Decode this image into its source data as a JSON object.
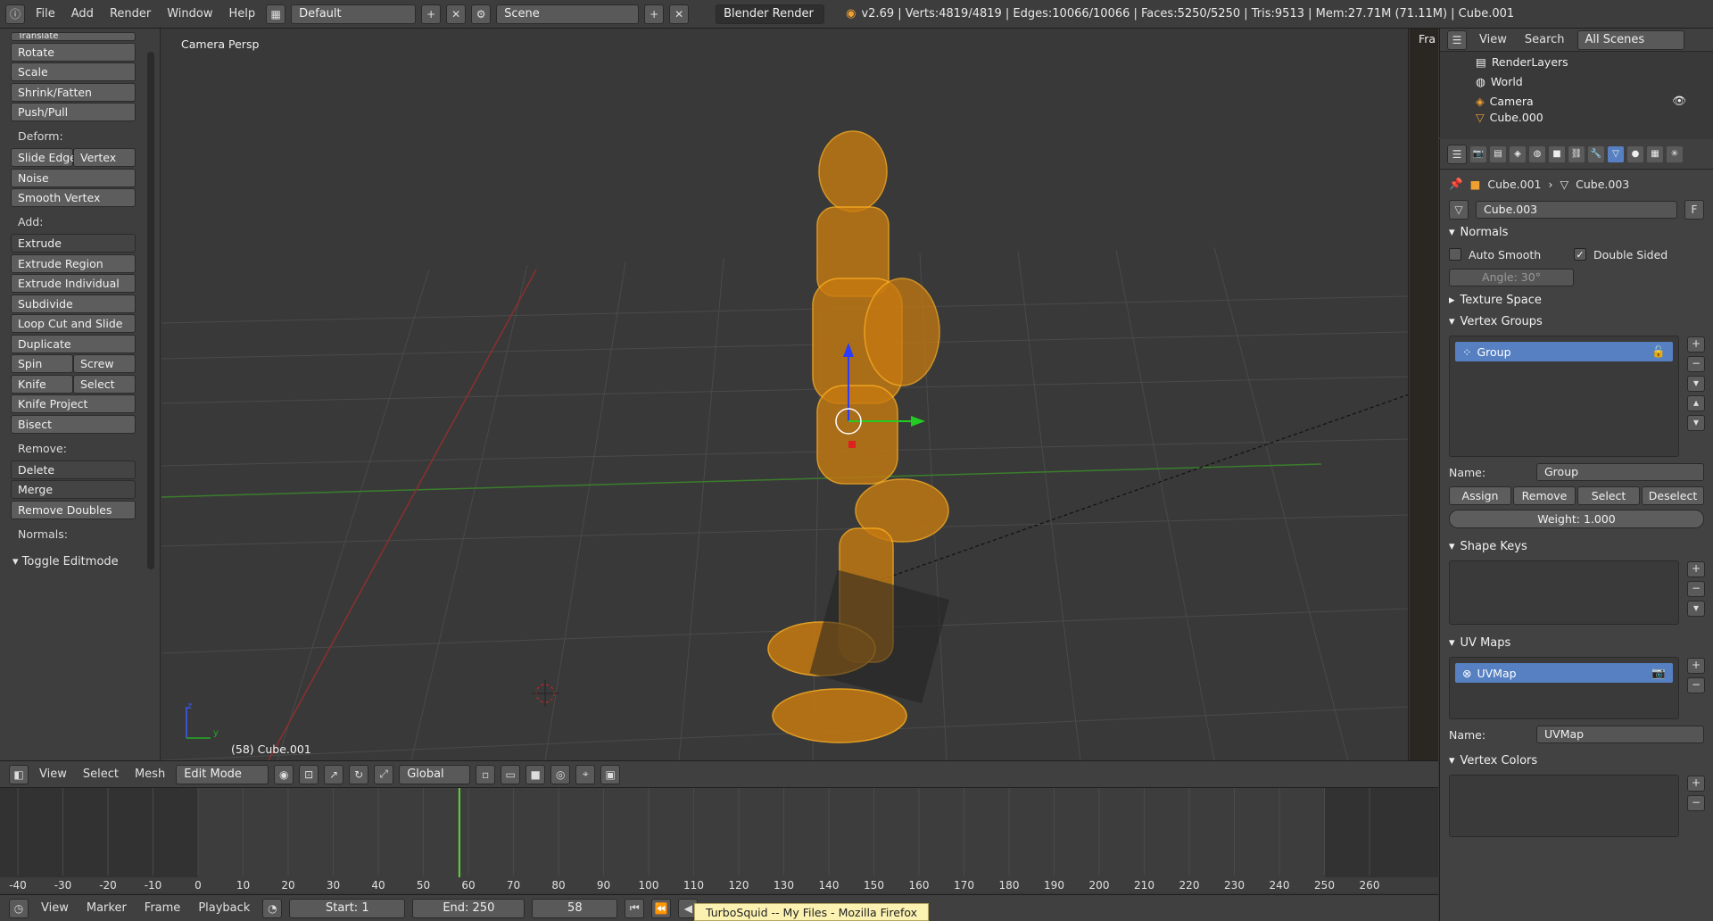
{
  "topbar": {
    "menus": [
      "File",
      "Add",
      "Render",
      "Window",
      "Help"
    ],
    "layout": "Default",
    "scene": "Scene",
    "engine": "Blender Render",
    "stats": "v2.69 | Verts:4819/4819 | Edges:10066/10066 | Faces:5250/5250 | Tris:9513 | Mem:27.71M (71.11M) | Cube.001"
  },
  "toolshelf": {
    "top_cut": "Translate",
    "transform_items": [
      "Rotate",
      "Scale",
      "Shrink/Fatten",
      "Push/Pull"
    ],
    "deform_label": "Deform:",
    "slide_edge": "Slide Edge",
    "vertex": "Vertex",
    "noise": "Noise",
    "smooth_vertex": "Smooth Vertex",
    "add_label": "Add:",
    "extrude": "Extrude",
    "extrude_region": "Extrude Region",
    "extrude_individual": "Extrude Individual",
    "subdivide": "Subdivide",
    "loop_cut": "Loop Cut and Slide",
    "duplicate": "Duplicate",
    "spin": "Spin",
    "screw": "Screw",
    "knife": "Knife",
    "select": "Select",
    "knife_project": "Knife Project",
    "bisect": "Bisect",
    "remove_label": "Remove:",
    "delete": "Delete",
    "merge": "Merge",
    "remove_doubles": "Remove Doubles",
    "normals_label": "Normals:",
    "toggle": "Toggle Editmode"
  },
  "viewport": {
    "view_name": "Camera Persp",
    "object_label": "(58) Cube.001",
    "corner_label": "Fra",
    "axis_z": "z",
    "axis_y": "y"
  },
  "vp_header": {
    "menus": [
      "View",
      "Select",
      "Mesh"
    ],
    "mode": "Edit Mode",
    "orientation": "Global"
  },
  "timeline": {
    "ticks": [
      "-40",
      "-30",
      "-20",
      "-10",
      "0",
      "10",
      "20",
      "30",
      "40",
      "50",
      "60",
      "70",
      "80",
      "90",
      "100",
      "110",
      "120",
      "130",
      "140",
      "150",
      "160",
      "170",
      "180",
      "190",
      "200",
      "210",
      "220",
      "230",
      "240",
      "250",
      "260"
    ],
    "current_frame": 58,
    "menus": [
      "View",
      "Marker",
      "Frame",
      "Playback"
    ],
    "start": "Start: 1",
    "end": "End: 250",
    "frame": "58",
    "tooltip": "TurboSquid -- My Files - Mozilla Firefox"
  },
  "outliner": {
    "view": "View",
    "search": "Search",
    "filter": "All Scenes",
    "items": [
      "RenderLayers",
      "World",
      "Camera",
      "Cube.000"
    ]
  },
  "props": {
    "breadcrumb_obj": "Cube.001",
    "breadcrumb_data": "Cube.003",
    "data_name": "Cube.003",
    "fake_user": "F",
    "normals": "Normals",
    "auto_smooth": "Auto Smooth",
    "double_sided": "Double Sided",
    "angle": "Angle: 30°",
    "texture_space": "Texture Space",
    "vertex_groups": "Vertex Groups",
    "group_item": "Group",
    "name_label": "Name:",
    "group_name": "Group",
    "assign": "Assign",
    "remove": "Remove",
    "select": "Select",
    "deselect": "Deselect",
    "weight": "Weight: 1.000",
    "shape_keys": "Shape Keys",
    "uv_maps": "UV Maps",
    "uv_item": "UVMap",
    "uv_name": "UVMap",
    "vertex_colors": "Vertex Colors"
  }
}
